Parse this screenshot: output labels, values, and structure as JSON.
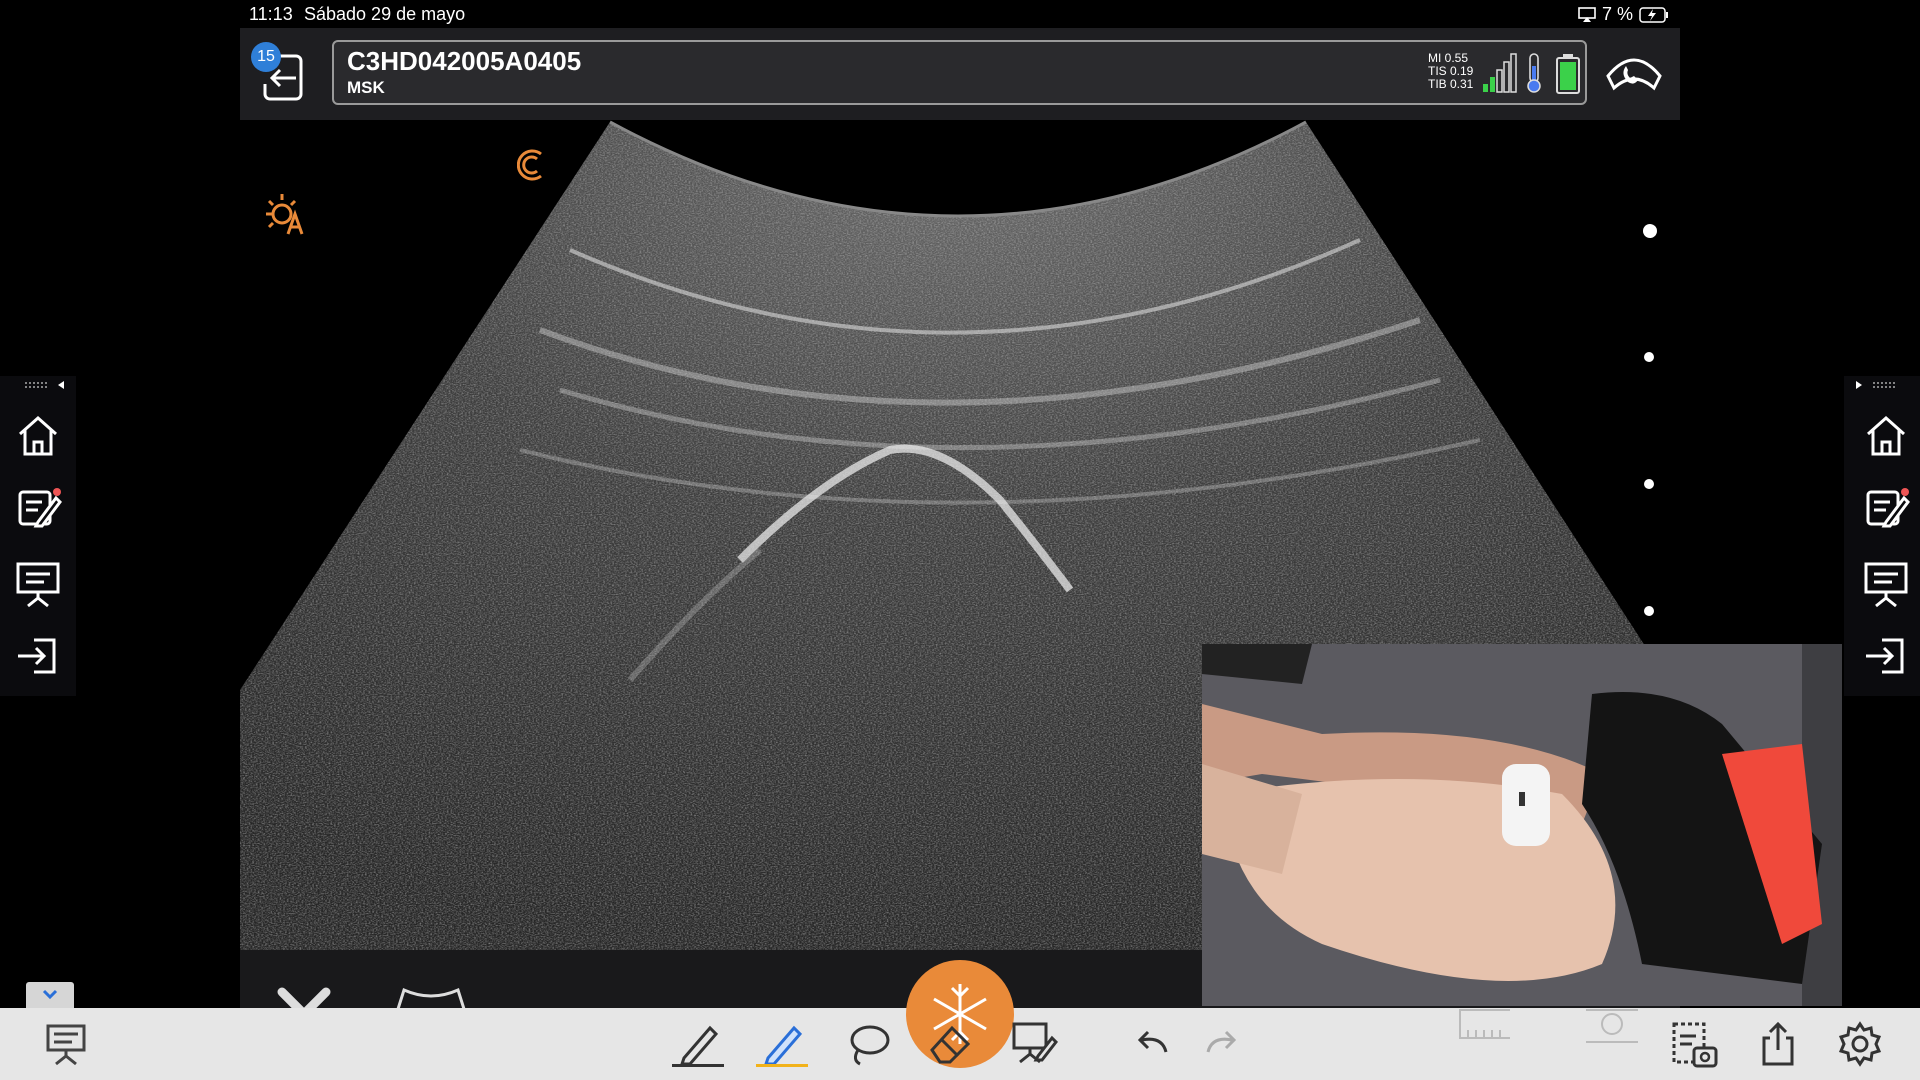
{
  "status_bar": {
    "time": "11:13",
    "date": "Sábado 29 de mayo",
    "battery": "7 %"
  },
  "header": {
    "notification_count": "15",
    "patient_id": "C3HD042005A0405",
    "preset": "MSK",
    "acoustic": {
      "mi": "MI 0.55",
      "tis": "TIS 0.19",
      "tib": "TIB 0.31"
    }
  },
  "colors": {
    "accent": "#e98a39",
    "badge": "#2f7fd8",
    "battery": "#3bd14a",
    "pen_underline": "#f2b21a"
  },
  "toolbar": {
    "items": [
      "presentation-icon",
      "close-tool-icon",
      "bmode-icon",
      "pencil-icon",
      "marker-icon",
      "lasso-icon",
      "freeze-snowflake-icon",
      "eraser-icon",
      "annotate-icon",
      "undo-icon",
      "redo-icon",
      "cine-icon",
      "camera-icon",
      "clipboard-capture-icon",
      "share-icon",
      "settings-icon"
    ]
  }
}
